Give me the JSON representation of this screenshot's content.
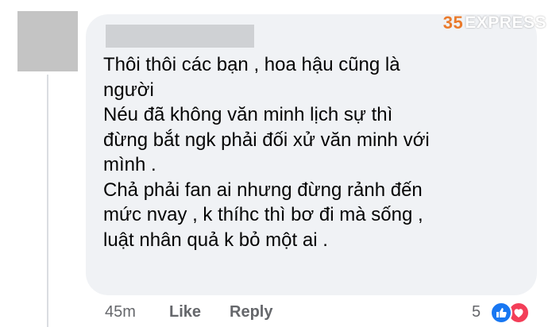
{
  "watermark": {
    "brand": "EXPRESS",
    "mark": "35"
  },
  "comment": {
    "text": "Thôi thôi các bạn , hoa hậu cũng là\nngười\nNéu đã không văn minh lịch sự thì\nđừng bắt ngk phải đối xử văn minh với\nmình .\nChả phải fan ai nhưng đừng rảnh đến\nmức nvay , k thíhc thì bơ đi mà sống ,\nluật nhân quả k bỏ một ai ."
  },
  "actions": {
    "time": "45m",
    "like_label": "Like",
    "reply_label": "Reply",
    "reaction_count": "5"
  },
  "reactions": [
    {
      "name": "like",
      "icon": "thumbs-up-icon",
      "color": "#1877f2"
    },
    {
      "name": "love",
      "icon": "heart-icon",
      "color": "#f33e58"
    }
  ],
  "colors": {
    "bubble": "#f0f2f5",
    "text": "#050505",
    "secondary": "#65676b",
    "watermark_accent": "#ea7a2b"
  }
}
